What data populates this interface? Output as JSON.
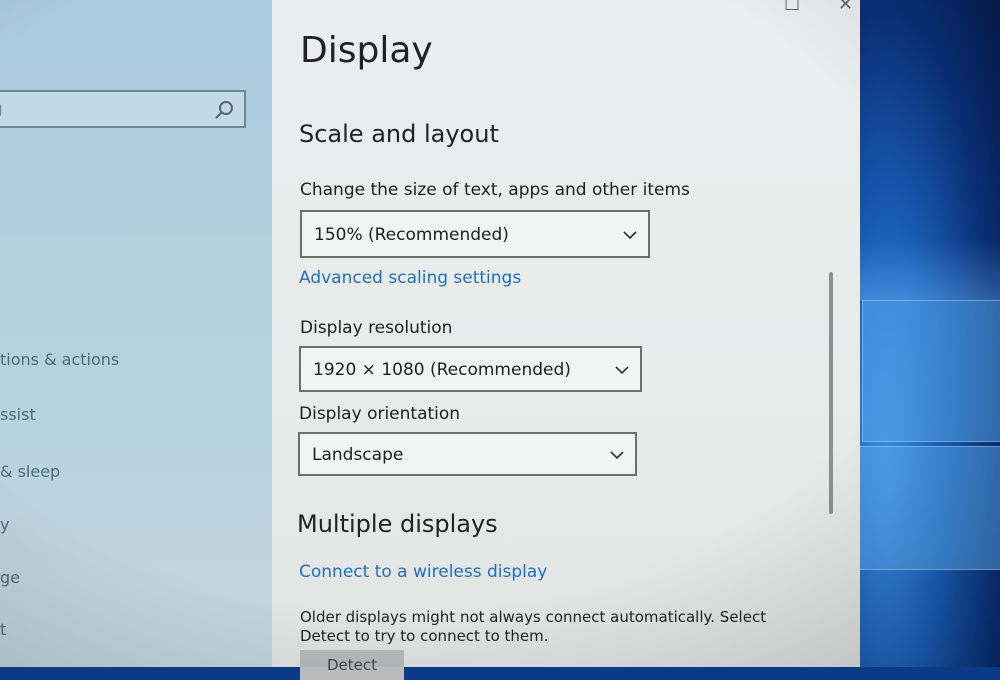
{
  "window": {
    "maximize_glyph": "☐",
    "close_glyph": "✕"
  },
  "sidebar": {
    "search": {
      "placeholder": "g"
    },
    "items": [
      {
        "label": "tions & actions"
      },
      {
        "label": "ssist"
      },
      {
        "label": "& sleep"
      },
      {
        "label": "y"
      },
      {
        "label": "ge"
      },
      {
        "label": "t"
      }
    ]
  },
  "main": {
    "title": "Display",
    "scale_layout": {
      "heading": "Scale and layout",
      "size_label": "Change the size of text, apps and other items",
      "size_value": "150% (Recommended)",
      "advanced_link": "Advanced scaling settings",
      "resolution_label": "Display resolution",
      "resolution_value": "1920 × 1080 (Recommended)",
      "orientation_label": "Display orientation",
      "orientation_value": "Landscape"
    },
    "multiple_displays": {
      "heading": "Multiple displays",
      "wireless_link": "Connect to a wireless display",
      "description": "Older displays might not always connect automatically. Select Detect to try to connect to them.",
      "detect_button": "Detect"
    }
  },
  "colors": {
    "accent_link": "#1f6fbf",
    "panel_bg": "#ebeeee",
    "sidebar_bg": "#b6d2df"
  }
}
